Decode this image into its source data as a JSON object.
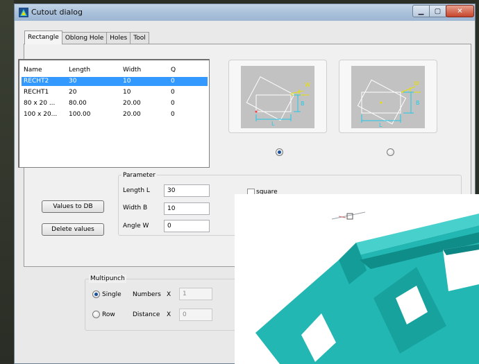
{
  "window": {
    "title": "Cutout dialog"
  },
  "tabs": [
    "Rectangle",
    "Oblong Hole",
    "Holes",
    "Tool"
  ],
  "list": {
    "columns": [
      "Name",
      "Length",
      "Width",
      "Q"
    ],
    "rows": [
      [
        "RECHT2",
        "30",
        "10",
        "0"
      ],
      [
        "RECHT1",
        "20",
        "10",
        "0"
      ],
      [
        "80 x 20 ...",
        "80.00",
        "20.00",
        "0"
      ],
      [
        "100 x 20...",
        "100.00",
        "20.00",
        "0"
      ]
    ],
    "selected_row": 0
  },
  "previews": {
    "left": {
      "label_w": "W",
      "label_b": "B",
      "label_l": "L"
    },
    "right": {
      "label_w": "W",
      "label_b": "B",
      "label_l": "L"
    },
    "selected": "left"
  },
  "parameter": {
    "title": "Parameter",
    "length_label": "Length L",
    "length_value": "30",
    "width_label": "Width B",
    "width_value": "10",
    "angle_label": "Angle W",
    "angle_value": "0",
    "square_label": "square"
  },
  "buttons": {
    "values_to_db": "Values to DB",
    "delete_values": "Delete values"
  },
  "multipunch": {
    "title": "Multipunch",
    "single_label": "Single",
    "row_label": "Row",
    "numbers_label": "Numbers",
    "distance_label": "Distance",
    "x_label": "X",
    "numbers_value": "1",
    "distance_value": "0",
    "selected": "single"
  },
  "colors": {
    "selection": "#3399ff",
    "dimension_yellow": "#e8e000",
    "dimension_cyan": "#22c8e6",
    "part_teal": "#1fb5b1"
  }
}
